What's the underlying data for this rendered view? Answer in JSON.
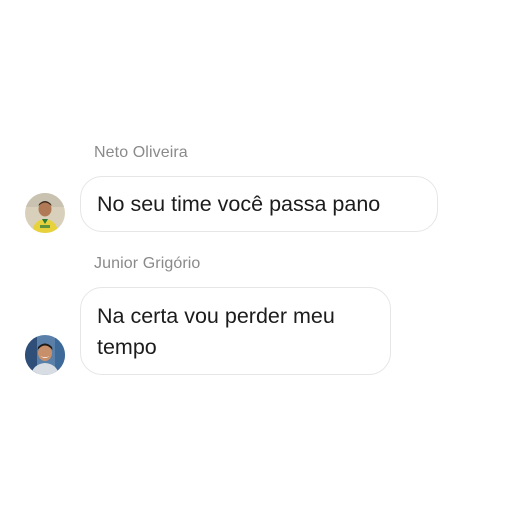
{
  "messages": [
    {
      "sender": "Neto Oliveira",
      "text": "No seu time você passa pano",
      "avatar_icon": "user-avatar-icon"
    },
    {
      "sender": "Junior Grigório",
      "text": "Na certa vou perder meu tempo",
      "avatar_icon": "user-avatar-icon"
    }
  ],
  "colors": {
    "background": "#ffffff",
    "name_text": "#8a8a8a",
    "message_text": "#1c1c1c",
    "bubble_border": "#e6e6e6"
  }
}
